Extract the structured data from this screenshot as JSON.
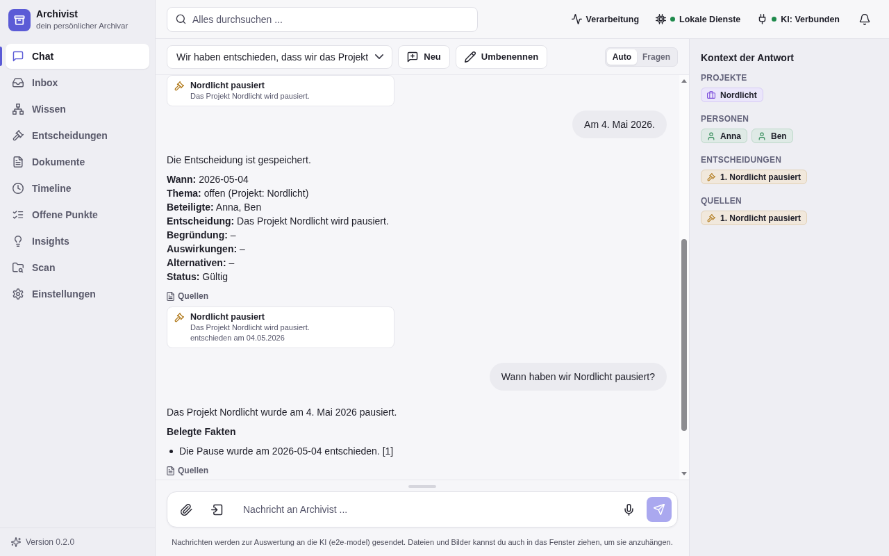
{
  "app": {
    "name": "Archivist",
    "tagline": "dein persönlicher Archivar"
  },
  "sidebar": {
    "items": [
      {
        "label": "Chat",
        "selected": true
      },
      {
        "label": "Inbox",
        "selected": false
      },
      {
        "label": "Wissen",
        "selected": false
      },
      {
        "label": "Entscheidungen",
        "selected": false
      },
      {
        "label": "Dokumente",
        "selected": false
      },
      {
        "label": "Timeline",
        "selected": false
      },
      {
        "label": "Offene Punkte",
        "selected": false
      },
      {
        "label": "Insights",
        "selected": false
      },
      {
        "label": "Scan",
        "selected": false
      },
      {
        "label": "Einstellungen",
        "selected": false
      }
    ],
    "version": "Version 0.2.0"
  },
  "search": {
    "placeholder": "Alles durchsuchen ..."
  },
  "status_items": [
    {
      "kind": "activity",
      "label": "Verarbeitung"
    },
    {
      "kind": "service",
      "label": "Lokale Dienste",
      "online": true
    },
    {
      "kind": "connection",
      "label": "KI: Verbunden",
      "online": true
    }
  ],
  "conversation": {
    "title": "Wir haben entschieden, dass wir das Projekt",
    "actions": [
      {
        "kind": "new",
        "label": "Neu"
      },
      {
        "kind": "rename",
        "label": "Umbenennen"
      }
    ],
    "modes": [
      {
        "label": "Auto",
        "selected": true
      },
      {
        "label": "Fragen",
        "selected": false
      }
    ]
  },
  "messages": [
    {
      "kind": "assistant",
      "blocks": [
        {
          "kind": "source",
          "title": "Nordlicht pausiert",
          "description": "Das Projekt Nordlicht wird pausiert."
        }
      ]
    },
    {
      "kind": "user",
      "text": "Am 4. Mai 2026."
    },
    {
      "kind": "assistant",
      "blocks": [
        {
          "kind": "paragraph",
          "text": "Die Entscheidung ist gespeichert."
        },
        {
          "kind": "fields",
          "lines": [
            "**Wann:** 2026-05-04",
            "**Thema:** offen (Projekt: Nordlicht)",
            "**Beteiligte:** Anna, Ben",
            "**Entscheidung:** Das Projekt Nordlicht wird pausiert.",
            "**Begründung:** –",
            "**Auswirkungen:** –",
            "**Alternativen:** –",
            "**Status:** Gültig"
          ]
        },
        {
          "kind": "sources_label",
          "text": "Quellen"
        },
        {
          "kind": "source",
          "title": "Nordlicht pausiert",
          "description": "Das Projekt Nordlicht wird pausiert.",
          "date": "entschieden am 04.05.2026"
        }
      ]
    },
    {
      "kind": "user",
      "text": "Wann haben wir Nordlicht pausiert?"
    },
    {
      "kind": "assistant",
      "blocks": [
        {
          "kind": "paragraph",
          "text": "Das Projekt Nordlicht wurde am 4. Mai 2026 pausiert."
        },
        {
          "kind": "heading",
          "text": "Belegte Fakten"
        },
        {
          "kind": "list",
          "items": [
            "Die Pause wurde am 2026-05-04 entschieden. [1]"
          ]
        },
        {
          "kind": "sources_label",
          "text": "Quellen"
        }
      ]
    }
  ],
  "composer": {
    "placeholder": "Nachricht an Archivist ...",
    "send_disabled": true,
    "note": "Nachrichten werden zur Auswertung an die KI (e2e-model) gesendet. Dateien und Bilder kannst du auch in das Fenster ziehen, um sie anzuhängen."
  },
  "context": {
    "title": "Kontext der Antwort",
    "sections": [
      {
        "label": "PROJEKTE",
        "chips": [
          {
            "kind": "project",
            "label": "Nordlicht"
          }
        ]
      },
      {
        "label": "PERSONEN",
        "chips": [
          {
            "kind": "person",
            "label": "Anna"
          },
          {
            "kind": "person",
            "label": "Ben"
          }
        ]
      },
      {
        "label": "ENTSCHEIDUNGEN",
        "chips": [
          {
            "kind": "decision",
            "label": "1. Nordlicht pausiert"
          }
        ]
      },
      {
        "label": "QUELLEN",
        "chips": [
          {
            "kind": "decision",
            "label": "1. Nordlicht pausiert"
          }
        ]
      }
    ]
  }
}
